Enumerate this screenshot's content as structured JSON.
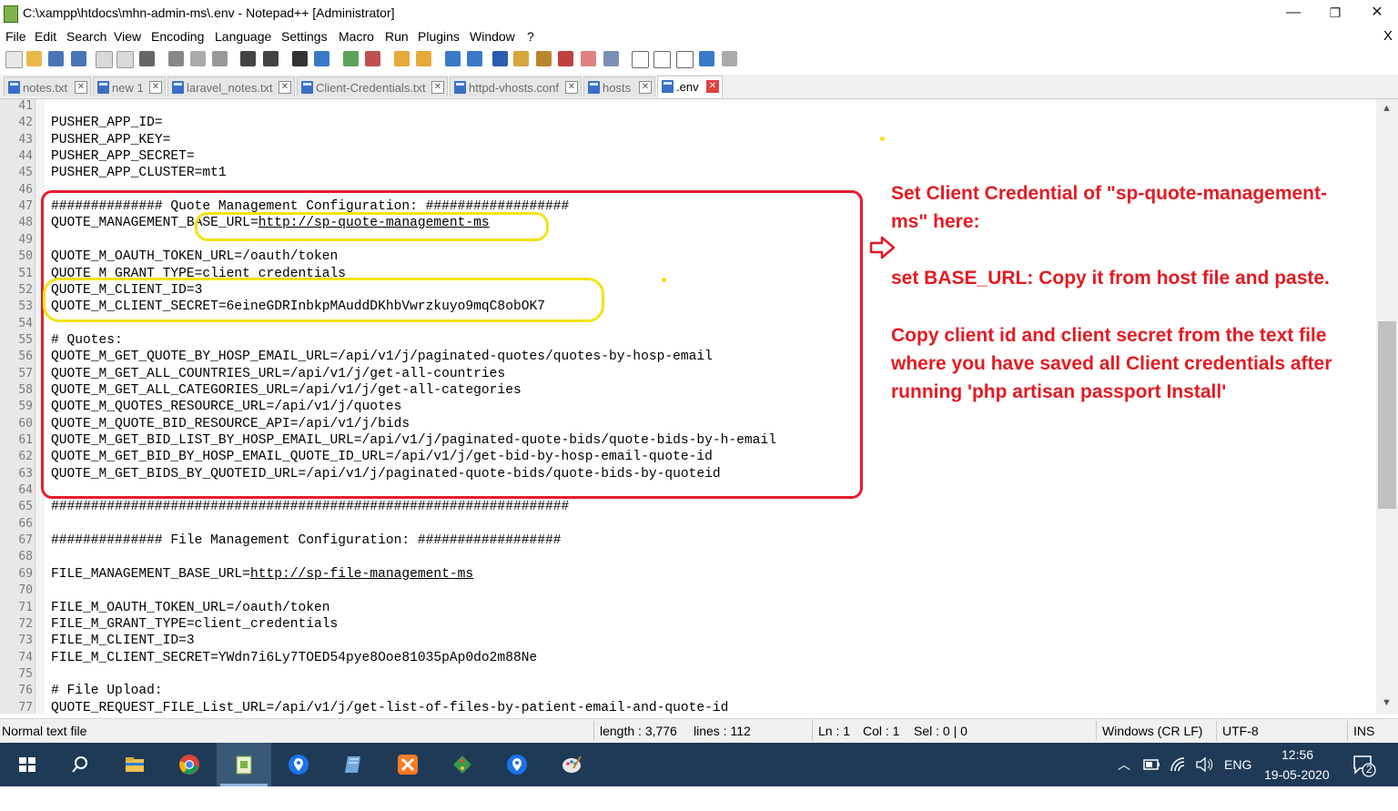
{
  "window": {
    "title": "C:\\xampp\\htdocs\\mhn-admin-ms\\.env - Notepad++ [Administrator]",
    "minimize": "—",
    "maximize": "❐",
    "close": "✕"
  },
  "menu": {
    "items": [
      "File",
      "Edit",
      "Search",
      "View",
      "Encoding",
      "Language",
      "Settings",
      "Macro",
      "Run",
      "Plugins",
      "Window",
      "?"
    ],
    "close_doc": "X"
  },
  "tabs": [
    {
      "label": "notes.txt",
      "active": false
    },
    {
      "label": "new 1",
      "active": false
    },
    {
      "label": "laravel_notes.txt",
      "active": false
    },
    {
      "label": "Client-Credentials.txt",
      "active": false
    },
    {
      "label": "httpd-vhosts.conf",
      "active": false
    },
    {
      "label": "hosts",
      "active": false
    },
    {
      "label": ".env",
      "active": true
    }
  ],
  "editor": {
    "lines": [
      {
        "n": "41",
        "text": ""
      },
      {
        "n": "42",
        "text": "PUSHER_APP_ID="
      },
      {
        "n": "43",
        "text": "PUSHER_APP_KEY="
      },
      {
        "n": "44",
        "text": "PUSHER_APP_SECRET="
      },
      {
        "n": "45",
        "text": "PUSHER_APP_CLUSTER=mt1"
      },
      {
        "n": "46",
        "text": ""
      },
      {
        "n": "47",
        "text": "############## Quote Management Configuration: ##################"
      },
      {
        "n": "48",
        "text": "QUOTE_MANAGEMENT_BASE_URL=",
        "url": "http://sp-quote-management-ms"
      },
      {
        "n": "49",
        "text": ""
      },
      {
        "n": "50",
        "text": "QUOTE_M_OAUTH_TOKEN_URL=/oauth/token"
      },
      {
        "n": "51",
        "text": "QUOTE_M_GRANT_TYPE=client_credentials"
      },
      {
        "n": "52",
        "text": "QUOTE_M_CLIENT_ID=3"
      },
      {
        "n": "53",
        "text": "QUOTE_M_CLIENT_SECRET=6eineGDRInbkpMAuddDKhbVwrzkuyo9mqC8obOK7"
      },
      {
        "n": "54",
        "text": ""
      },
      {
        "n": "55",
        "text": "# Quotes:"
      },
      {
        "n": "56",
        "text": "QUOTE_M_GET_QUOTE_BY_HOSP_EMAIL_URL=/api/v1/j/paginated-quotes/quotes-by-hosp-email"
      },
      {
        "n": "57",
        "text": "QUOTE_M_GET_ALL_COUNTRIES_URL=/api/v1/j/get-all-countries"
      },
      {
        "n": "58",
        "text": "QUOTE_M_GET_ALL_CATEGORIES_URL=/api/v1/j/get-all-categories"
      },
      {
        "n": "59",
        "text": "QUOTE_M_QUOTES_RESOURCE_URL=/api/v1/j/quotes"
      },
      {
        "n": "60",
        "text": "QUOTE_M_QUOTE_BID_RESOURCE_API=/api/v1/j/bids"
      },
      {
        "n": "61",
        "text": "QUOTE_M_GET_BID_LIST_BY_HOSP_EMAIL_URL=/api/v1/j/paginated-quote-bids/quote-bids-by-h-email"
      },
      {
        "n": "62",
        "text": "QUOTE_M_GET_BID_BY_HOSP_EMAIL_QUOTE_ID_URL=/api/v1/j/get-bid-by-hosp-email-quote-id"
      },
      {
        "n": "63",
        "text": "QUOTE_M_GET_BIDS_BY_QUOTEID_URL=/api/v1/j/paginated-quote-bids/quote-bids-by-quoteid"
      },
      {
        "n": "64",
        "text": ""
      },
      {
        "n": "65",
        "text": "#################################################################"
      },
      {
        "n": "66",
        "text": ""
      },
      {
        "n": "67",
        "text": "############## File Management Configuration: ##################"
      },
      {
        "n": "68",
        "text": ""
      },
      {
        "n": "69",
        "text": "FILE_MANAGEMENT_BASE_URL=",
        "url": "http://sp-file-management-ms"
      },
      {
        "n": "70",
        "text": ""
      },
      {
        "n": "71",
        "text": "FILE_M_OAUTH_TOKEN_URL=/oauth/token"
      },
      {
        "n": "72",
        "text": "FILE_M_GRANT_TYPE=client_credentials"
      },
      {
        "n": "73",
        "text": "FILE_M_CLIENT_ID=3"
      },
      {
        "n": "74",
        "text": "FILE_M_CLIENT_SECRET=YWdn7i6Ly7TOED54pye8Ooe81035pAp0do2m88Ne"
      },
      {
        "n": "75",
        "text": ""
      },
      {
        "n": "76",
        "text": "# File Upload:"
      },
      {
        "n": "77",
        "text": "QUOTE_REQUEST_FILE_List_URL=/api/v1/j/get-list-of-files-by-patient-email-and-quote-id"
      }
    ]
  },
  "annotation": {
    "lines": [
      "Set Client Credential of \"sp-quote-management-",
      "ms\" here:",
      "",
      "set BASE_URL: Copy it from host file and paste.",
      "",
      "Copy client id and client secret from the text file",
      "where you have saved all Client credentials after",
      "running 'php artisan passport Install'"
    ],
    "color": "#e31b23",
    "highlight_color": "#f2e313"
  },
  "status": {
    "file_type": "Normal text file",
    "length": "length : 3,776",
    "lines": "lines : 112",
    "ln": "Ln : 1",
    "col": "Col : 1",
    "sel": "Sel : 0 | 0",
    "eol": "Windows (CR LF)",
    "encoding": "UTF-8",
    "mode": "INS"
  },
  "taskbar": {
    "language": "ENG",
    "time": "12:56",
    "date": "19-05-2020",
    "notifications": "2"
  }
}
